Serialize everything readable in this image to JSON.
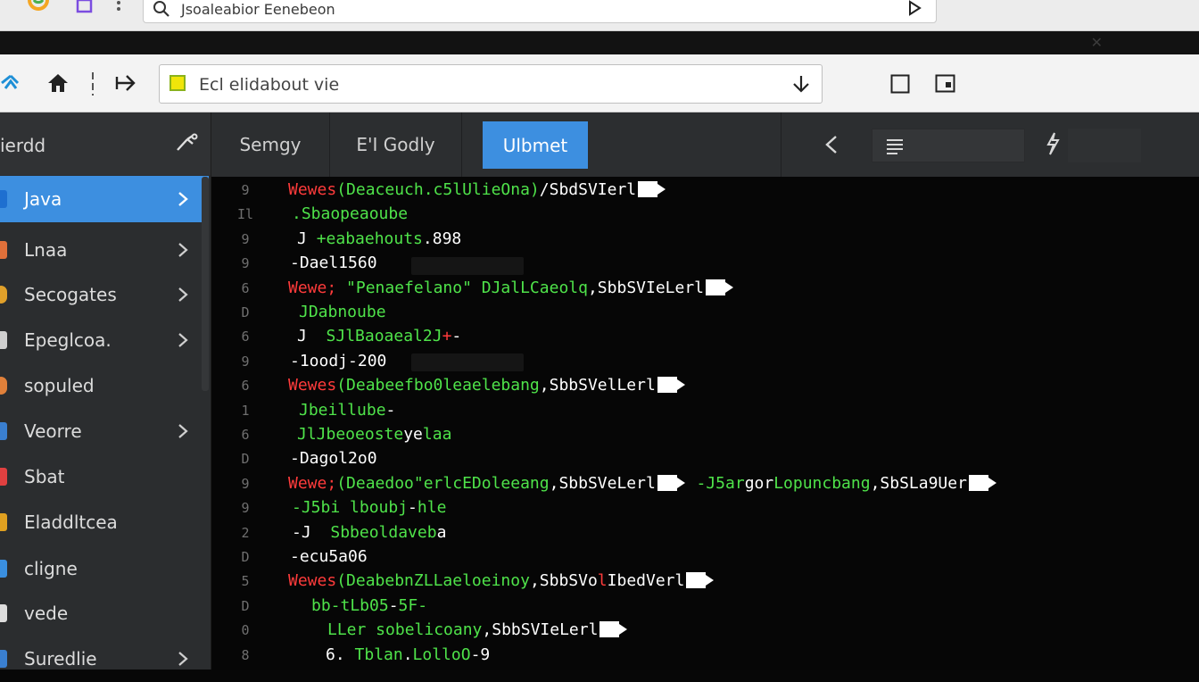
{
  "browser": {
    "search_query": "Jsoaleabior Eenebeon"
  },
  "nav": {
    "url_text": "Ecl elidabout vie"
  },
  "sidebar": {
    "title": "ierdd",
    "items": [
      {
        "label": "Java",
        "active": true,
        "chevron": true,
        "icon_color": "#1e6fd0"
      },
      {
        "label": "Lnaa",
        "active": false,
        "chevron": true,
        "icon_color": "#e0703a"
      },
      {
        "label": "Secogates",
        "active": false,
        "chevron": true,
        "icon_color": "#e0a02a"
      },
      {
        "label": "Epeglcoa.",
        "active": false,
        "chevron": true,
        "icon_color": "#cfcfcf"
      },
      {
        "label": "sopuled",
        "active": false,
        "chevron": false,
        "icon_color": "#e0803a"
      },
      {
        "label": "Veorre",
        "active": false,
        "chevron": true,
        "icon_color": "#3a7fd0"
      },
      {
        "label": "Sbat",
        "active": false,
        "chevron": false,
        "icon_color": "#e04040"
      },
      {
        "label": "Eladdltcea",
        "active": false,
        "chevron": false,
        "icon_color": "#e0a020"
      },
      {
        "label": "cligne",
        "active": false,
        "chevron": false,
        "icon_color": "#3a8fe0"
      },
      {
        "label": "vede",
        "active": false,
        "chevron": false,
        "icon_color": "#dddddd"
      },
      {
        "label": "Suredlie",
        "active": false,
        "chevron": true,
        "icon_color": "#3a7fd0"
      }
    ]
  },
  "tabs": [
    {
      "label": "Semgy",
      "active": false
    },
    {
      "label": "E'I Godly",
      "active": false
    },
    {
      "label": "Ulbmet",
      "active": true
    }
  ],
  "code": {
    "lines": [
      {
        "num": "9",
        "parts": [
          [
            "kw",
            "Wewes"
          ],
          [
            "gr",
            "(Deaceuch.c5lUlieOna)"
          ],
          [
            "wh",
            "/SbdSVIerl"
          ]
        ],
        "tag": true
      },
      {
        "num": "Il",
        "parts": [
          [
            "gr",
            ".Sbaopeaoube"
          ]
        ]
      },
      {
        "num": "9",
        "parts": [
          [
            "wh",
            "J "
          ],
          [
            "gr",
            "+eabaehouts"
          ],
          [
            "wh",
            ".898"
          ]
        ]
      },
      {
        "num": "9",
        "parts": [
          [
            "wh",
            "-Dael1560"
          ]
        ]
      },
      {
        "num": "6",
        "parts": [
          [
            "kw",
            "Wewe; "
          ],
          [
            "gr",
            "\"Penaefelano\" "
          ],
          [
            "gr",
            "DJalLCaeolq"
          ],
          [
            "wh",
            ",SbbSVIeLerl"
          ]
        ],
        "tag": true
      },
      {
        "num": "D",
        "parts": [
          [
            "gr",
            "JDabnoube"
          ]
        ]
      },
      {
        "num": "6",
        "parts": [
          [
            "wh",
            "J  "
          ],
          [
            "gr",
            "SJlBaoaeal2J"
          ],
          [
            "kw",
            "+"
          ],
          [
            "wh",
            "-"
          ]
        ]
      },
      {
        "num": "9",
        "parts": [
          [
            "wh",
            "-1oodj-200"
          ]
        ]
      },
      {
        "num": "6",
        "parts": [
          [
            "kw",
            "Wewes"
          ],
          [
            "gr",
            "(Deabeefbo0leaelebang"
          ],
          [
            "wh",
            ",SbbSVelLerl"
          ]
        ],
        "tag": true
      },
      {
        "num": "1",
        "parts": [
          [
            "gr",
            "Jbeillube"
          ],
          [
            "wh",
            "-"
          ]
        ]
      },
      {
        "num": "6",
        "parts": [
          [
            "gr",
            "JlJbeoeoste"
          ],
          [
            "wh",
            "ye"
          ],
          [
            "gr",
            "laa"
          ]
        ]
      },
      {
        "num": "D",
        "parts": [
          [
            "wh",
            "-Dagol2o0"
          ]
        ]
      },
      {
        "num": "9",
        "parts": [
          [
            "kw",
            "Wewe;"
          ],
          [
            "gr",
            "(Deaedoo\"erlcEDoleeang"
          ],
          [
            "wh",
            ",SbbSVeLerl"
          ]
        ],
        "tag": true,
        "extra": [
          [
            "gr",
            "  -J5ar"
          ],
          [
            "wh",
            "gor"
          ],
          [
            "gr",
            "Lopuncbang"
          ],
          [
            "wh",
            ",SbSLa9Uer"
          ]
        ],
        "extra_tag": true
      },
      {
        "num": "9",
        "parts": [
          [
            "gr",
            "-J5bi lboubj"
          ],
          [
            "wh",
            "-"
          ],
          [
            "gr",
            "hle"
          ]
        ]
      },
      {
        "num": "2",
        "parts": [
          [
            "wh",
            "-J  "
          ],
          [
            "gr",
            "Sbbeoldaveb"
          ],
          [
            "wh",
            "a"
          ]
        ]
      },
      {
        "num": "D",
        "parts": [
          [
            "wh",
            "-ecu5a06"
          ]
        ]
      },
      {
        "num": "5",
        "parts": [
          [
            "kw",
            "Wewes"
          ],
          [
            "gr",
            "(Deabebn"
          ],
          [
            "gr",
            "ZLLaeloeinoy"
          ],
          [
            "wh",
            ",SbbSVo"
          ],
          [
            "kw",
            "l"
          ],
          [
            "wh",
            "IbedVerl"
          ]
        ],
        "tag": true
      },
      {
        "num": "D",
        "parts": [
          [
            "gr",
            "bb-tLb05"
          ],
          [
            "wh",
            "-"
          ],
          [
            "gr",
            "5F-"
          ]
        ]
      },
      {
        "num": "0",
        "parts": [
          [
            "gr",
            "LLer sobelicoany"
          ],
          [
            "wh",
            ",SbbSVIeLerl"
          ]
        ],
        "tag": true
      },
      {
        "num": "8",
        "parts": [
          [
            "wh",
            "6. "
          ],
          [
            "gr",
            "Tblan"
          ],
          [
            "wh",
            "."
          ],
          [
            "gr",
            "LolloO"
          ],
          [
            "wh",
            "-9"
          ]
        ]
      }
    ]
  }
}
